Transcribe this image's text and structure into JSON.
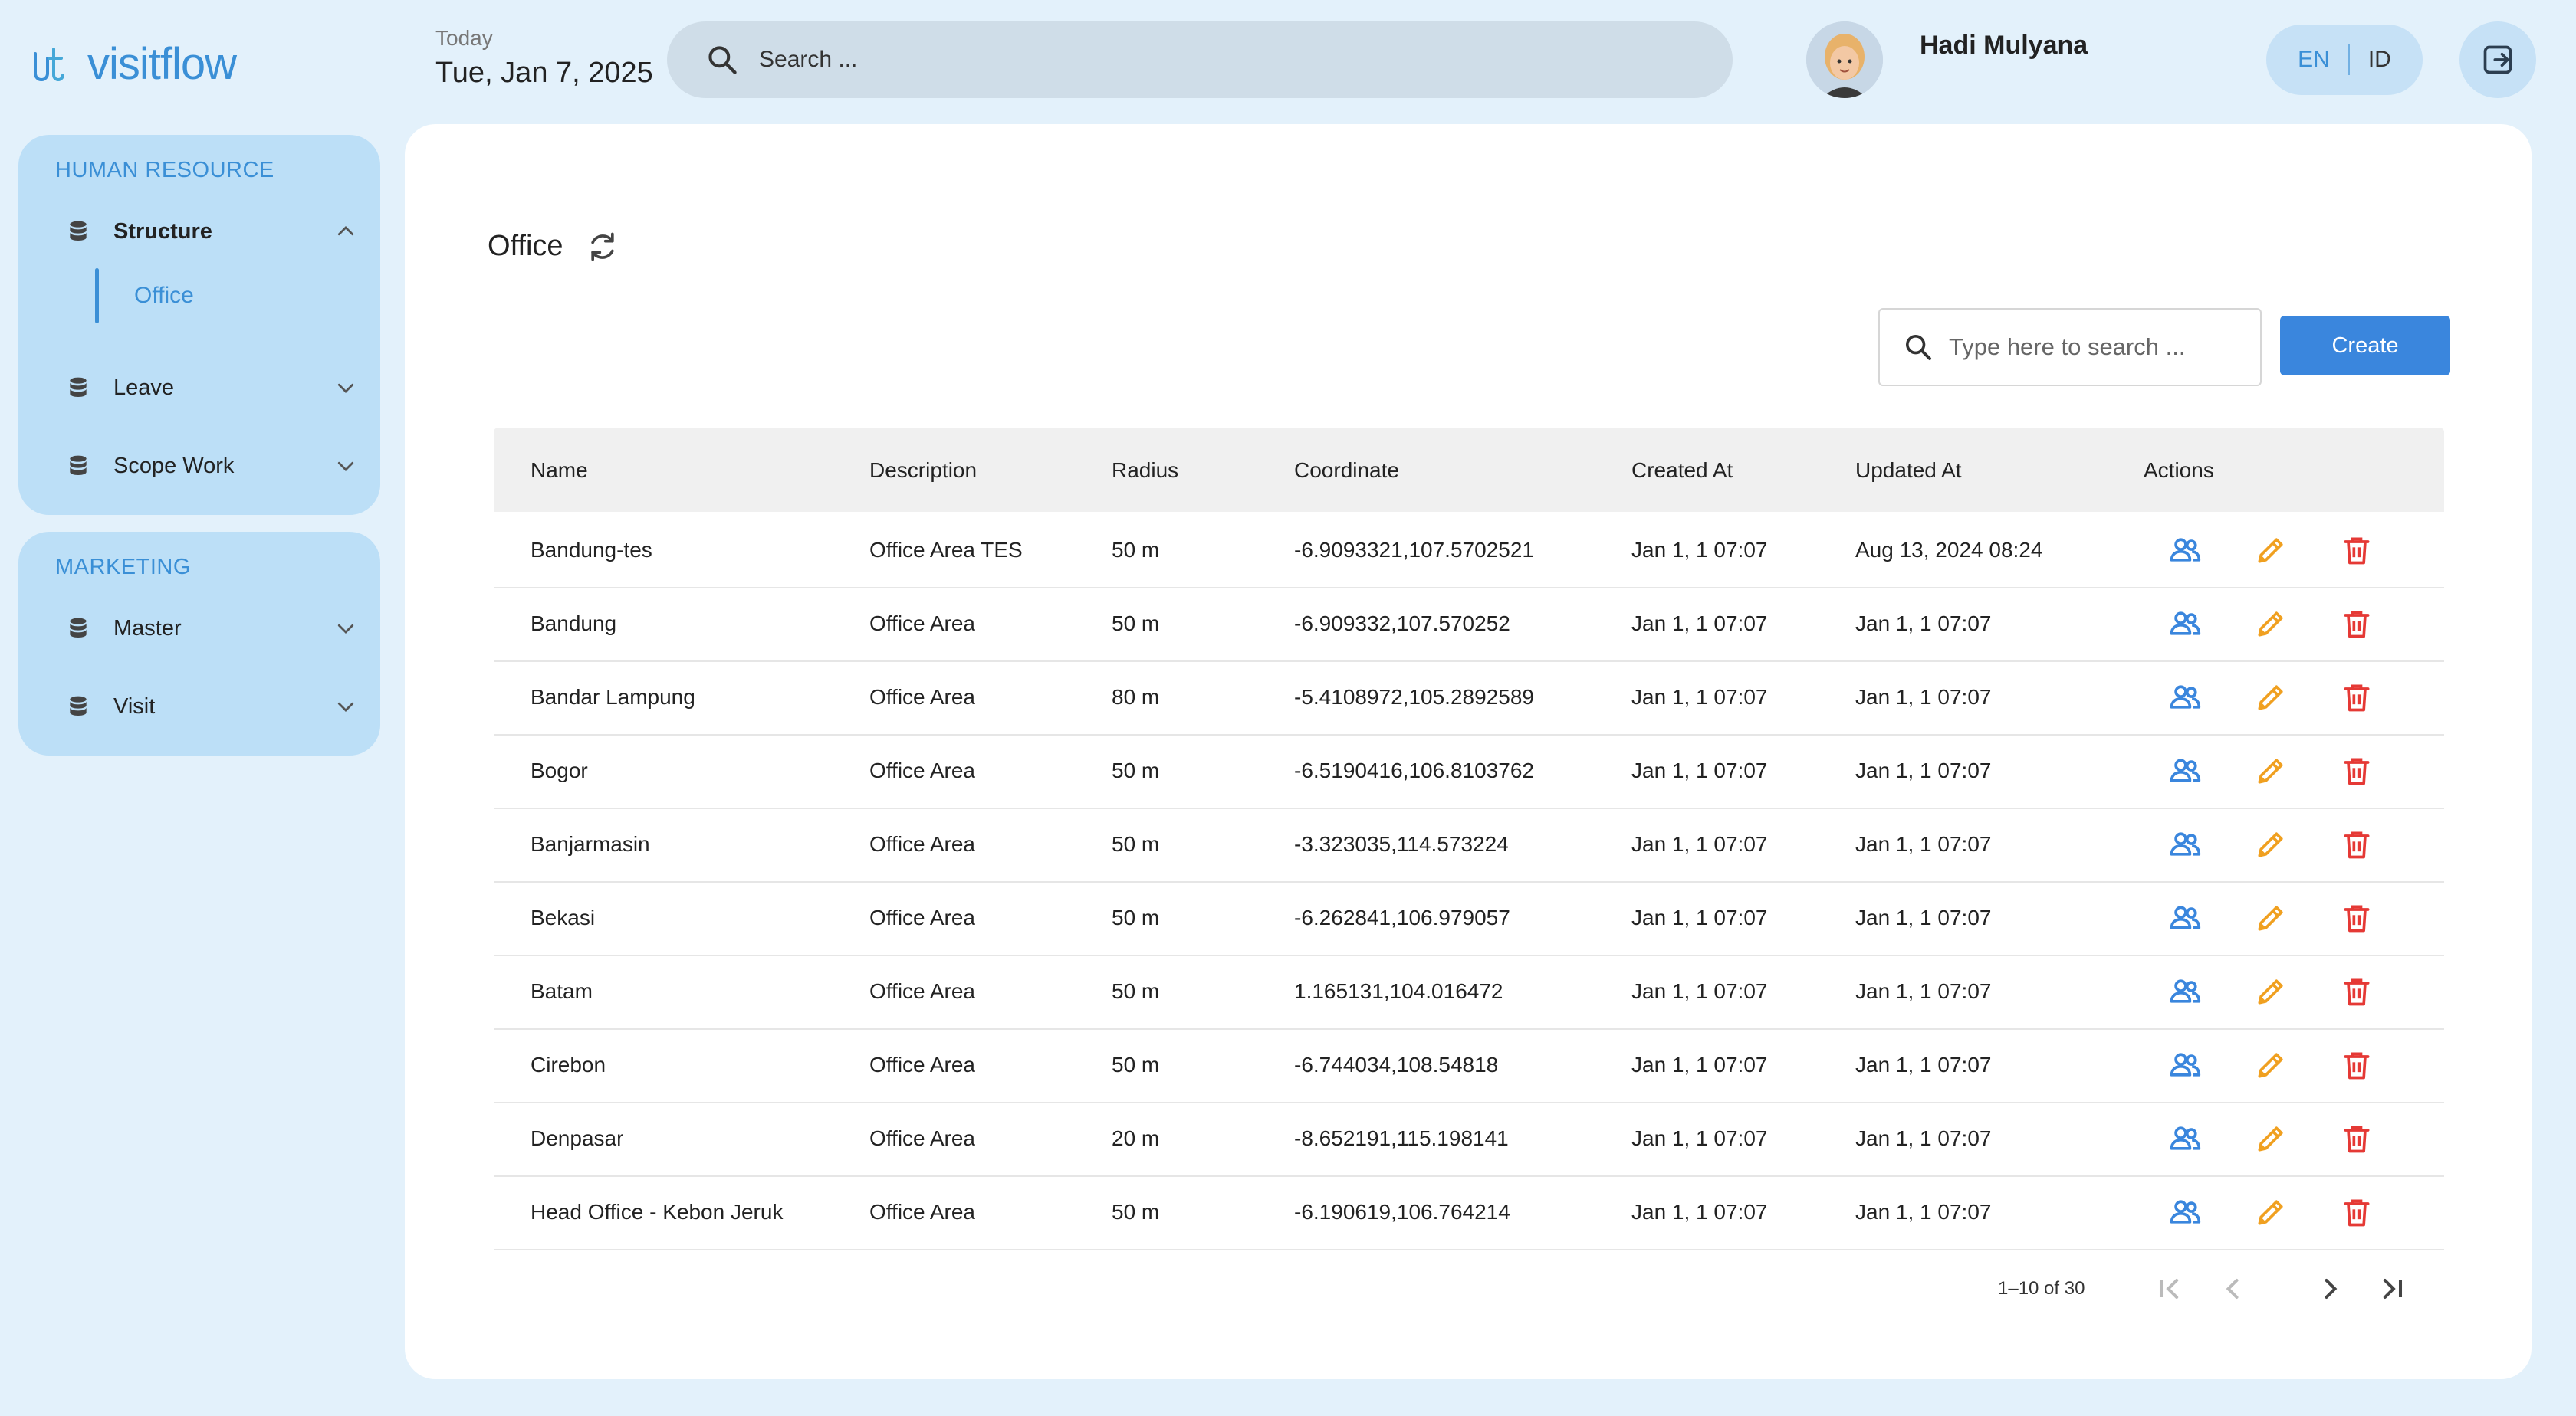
{
  "app": {
    "logo_text": "visitflow",
    "today_label": "Today",
    "today_date": "Tue, Jan 7, 2025",
    "search_placeholder": "Search ...",
    "user_name": "Hadi Mulyana",
    "lang_en": "EN",
    "lang_id": "ID"
  },
  "sidebar": {
    "groups": [
      {
        "title": "HUMAN RESOURCE",
        "items": [
          {
            "label": "Structure",
            "icon": "database-icon",
            "expanded": true,
            "sub": [
              "Office"
            ]
          },
          {
            "label": "Leave",
            "icon": "database-icon",
            "expanded": false
          },
          {
            "label": "Scope Work",
            "icon": "database-icon",
            "expanded": false
          }
        ]
      },
      {
        "title": "MARKETING",
        "items": [
          {
            "label": "Master",
            "icon": "database-icon",
            "expanded": false
          },
          {
            "label": "Visit",
            "icon": "database-icon",
            "expanded": false
          }
        ]
      }
    ]
  },
  "page": {
    "title": "Office",
    "search_placeholder": "Type here to search ...",
    "create_label": "Create"
  },
  "table": {
    "columns": [
      "Name",
      "Description",
      "Radius",
      "Coordinate",
      "Created At",
      "Updated At",
      "Actions"
    ],
    "rows": [
      [
        "Bandung-tes",
        "Office Area TES",
        "50 m",
        "-6.9093321,107.5702521",
        "Jan 1, 1 07:07",
        "Aug 13, 2024 08:24"
      ],
      [
        "Bandung",
        "Office Area",
        "50 m",
        "-6.909332,107.570252",
        "Jan 1, 1 07:07",
        "Jan 1, 1 07:07"
      ],
      [
        "Bandar Lampung",
        "Office Area",
        "80 m",
        "-5.4108972,105.2892589",
        "Jan 1, 1 07:07",
        "Jan 1, 1 07:07"
      ],
      [
        "Bogor",
        "Office Area",
        "50 m",
        "-6.5190416,106.8103762",
        "Jan 1, 1 07:07",
        "Jan 1, 1 07:07"
      ],
      [
        "Banjarmasin",
        "Office Area",
        "50 m",
        "-3.323035,114.573224",
        "Jan 1, 1 07:07",
        "Jan 1, 1 07:07"
      ],
      [
        "Bekasi",
        "Office Area",
        "50 m",
        "-6.262841,106.979057",
        "Jan 1, 1 07:07",
        "Jan 1, 1 07:07"
      ],
      [
        "Batam",
        "Office Area",
        "50 m",
        "1.165131,104.016472",
        "Jan 1, 1 07:07",
        "Jan 1, 1 07:07"
      ],
      [
        "Cirebon",
        "Office Area",
        "50 m",
        "-6.744034,108.54818",
        "Jan 1, 1 07:07",
        "Jan 1, 1 07:07"
      ],
      [
        "Denpasar",
        "Office Area",
        "20 m",
        "-8.652191,115.198141",
        "Jan 1, 1 07:07",
        "Jan 1, 1 07:07"
      ],
      [
        "Head Office - Kebon Jeruk",
        "Office Area",
        "50 m",
        "-6.190619,106.764214",
        "Jan 1, 1 07:07",
        "Jan 1, 1 07:07"
      ]
    ],
    "action_icons": [
      "users-icon",
      "pencil-icon",
      "trash-icon"
    ],
    "pagination": "1–10 of 30"
  },
  "colors": {
    "accent": "#3a86dd",
    "edit": "#f0a020",
    "delete": "#e53935",
    "sidebar_bg": "#bcdff7",
    "page_bg": "#e3f1fb"
  }
}
